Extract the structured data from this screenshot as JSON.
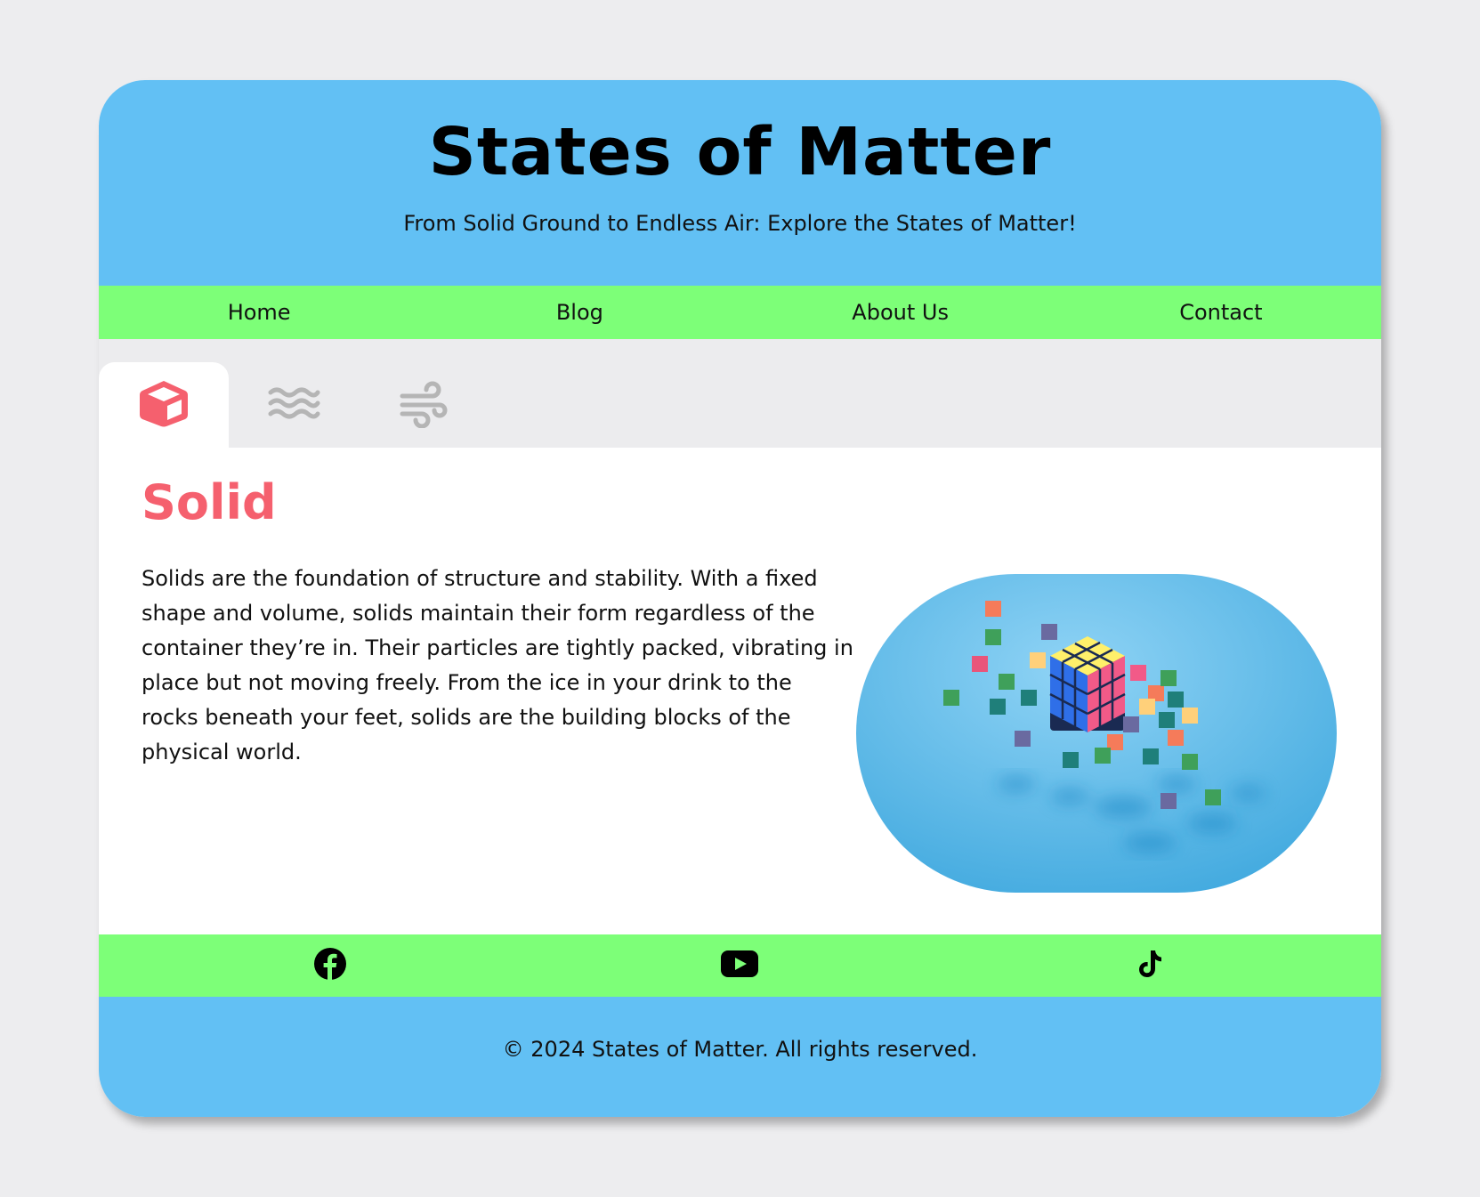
{
  "header": {
    "title": "States of Matter",
    "tagline": "From Solid Ground to Endless Air: Explore the States of Matter!"
  },
  "nav": {
    "items": [
      {
        "label": "Home"
      },
      {
        "label": "Blog"
      },
      {
        "label": "About Us"
      },
      {
        "label": "Contact"
      }
    ]
  },
  "tabs": [
    {
      "icon": "cube-icon",
      "active": true
    },
    {
      "icon": "water-waves-icon",
      "active": false
    },
    {
      "icon": "wind-icon",
      "active": false
    }
  ],
  "content": {
    "title": "Solid",
    "description": "Solids are the foundation of structure and stability. With a fixed shape and volume, solids maintain their form regardless of the container they’re in. Their particles are tightly packed, vibrating in place but not moving freely. From the ice in your drink to the rocks beneath your feet, solids are the building blocks of the physical world.",
    "image": "rubiks-cube-with-floating-cubes-photo"
  },
  "social": [
    {
      "icon": "facebook-icon"
    },
    {
      "icon": "youtube-icon"
    },
    {
      "icon": "tiktok-icon"
    }
  ],
  "footer": {
    "copyright": "© 2024 States of Matter. All rights reserved."
  },
  "colors": {
    "header_bg": "#62c0f4",
    "nav_bg": "#7dff78",
    "accent": "#f5606e",
    "inactive_icon": "#b5b5b5",
    "page_bg": "#ededef"
  }
}
